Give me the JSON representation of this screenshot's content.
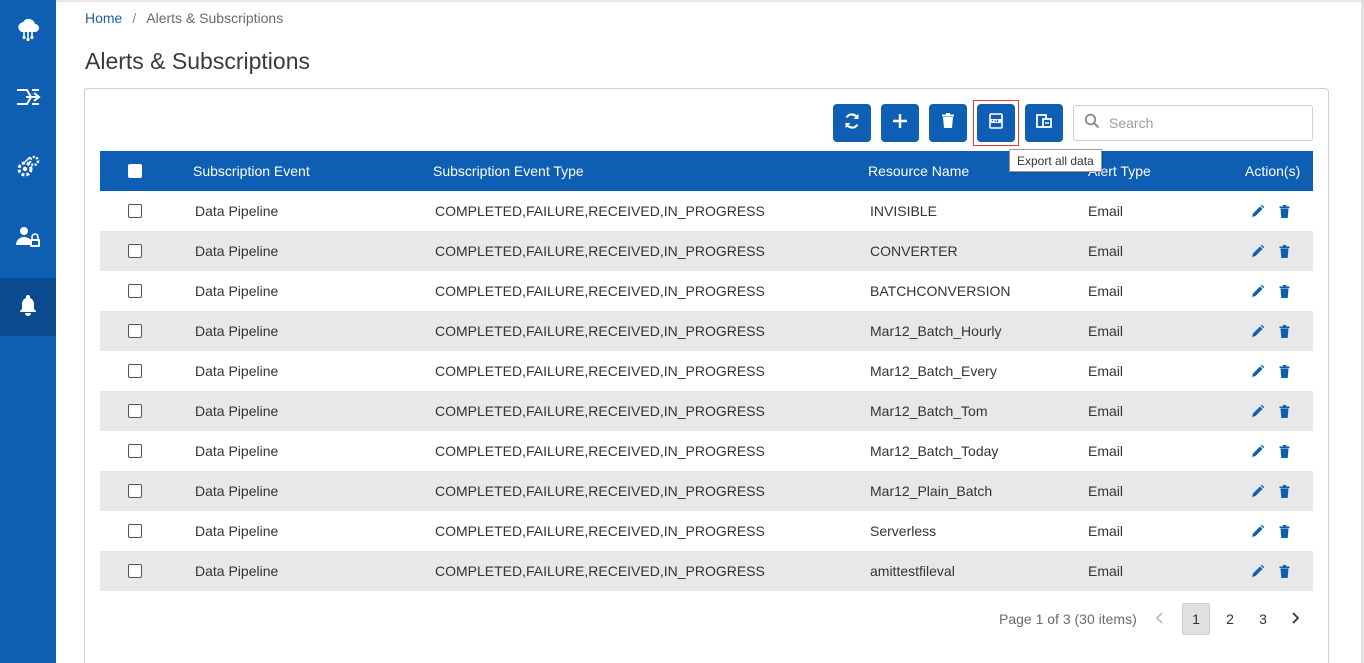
{
  "sidebar": {
    "items": [
      {
        "icon": "cloud-network-icon"
      },
      {
        "icon": "pipeline-flow-icon"
      },
      {
        "icon": "settings-gears-icon"
      },
      {
        "icon": "user-lock-icon"
      },
      {
        "icon": "bell-icon",
        "active": true
      }
    ]
  },
  "breadcrumb": {
    "home": "Home",
    "separator": "/",
    "current": "Alerts & Subscriptions"
  },
  "page_title": "Alerts & Subscriptions",
  "toolbar": {
    "buttons": [
      "refresh-icon",
      "plus-icon",
      "trash-icon",
      "xlsx-export-icon",
      "export-copy-icon"
    ],
    "tooltip": "Export all data",
    "search_placeholder": "Search"
  },
  "table": {
    "columns": [
      "Subscription Event",
      "Subscription Event Type",
      "Resource Name",
      "Alert Type",
      "Action(s)"
    ],
    "rows": [
      {
        "event": "Data Pipeline",
        "type": "COMPLETED,FAILURE,RECEIVED,IN_PROGRESS",
        "resource": "INVISIBLE",
        "alert": "Email"
      },
      {
        "event": "Data Pipeline",
        "type": "COMPLETED,FAILURE,RECEIVED,IN_PROGRESS",
        "resource": "CONVERTER",
        "alert": "Email"
      },
      {
        "event": "Data Pipeline",
        "type": "COMPLETED,FAILURE,RECEIVED,IN_PROGRESS",
        "resource": "BATCHCONVERSION",
        "alert": "Email"
      },
      {
        "event": "Data Pipeline",
        "type": "COMPLETED,FAILURE,RECEIVED,IN_PROGRESS",
        "resource": "Mar12_Batch_Hourly",
        "alert": "Email"
      },
      {
        "event": "Data Pipeline",
        "type": "COMPLETED,FAILURE,RECEIVED,IN_PROGRESS",
        "resource": "Mar12_Batch_Every",
        "alert": "Email"
      },
      {
        "event": "Data Pipeline",
        "type": "COMPLETED,FAILURE,RECEIVED,IN_PROGRESS",
        "resource": "Mar12_Batch_Tom",
        "alert": "Email"
      },
      {
        "event": "Data Pipeline",
        "type": "COMPLETED,FAILURE,RECEIVED,IN_PROGRESS",
        "resource": "Mar12_Batch_Today",
        "alert": "Email"
      },
      {
        "event": "Data Pipeline",
        "type": "COMPLETED,FAILURE,RECEIVED,IN_PROGRESS",
        "resource": "Mar12_Plain_Batch",
        "alert": "Email"
      },
      {
        "event": "Data Pipeline",
        "type": "COMPLETED,FAILURE,RECEIVED,IN_PROGRESS",
        "resource": "Serverless",
        "alert": "Email"
      },
      {
        "event": "Data Pipeline",
        "type": "COMPLETED,FAILURE,RECEIVED,IN_PROGRESS",
        "resource": "amittestfileval",
        "alert": "Email"
      }
    ]
  },
  "pagination": {
    "info": "Page 1 of 3 (30 items)",
    "pages": [
      "1",
      "2",
      "3"
    ],
    "current": "1"
  },
  "colors": {
    "primary": "#0e5fb3",
    "sidebar_active": "#0b4a8e",
    "row_alt": "#e8e8e8",
    "highlight": "#e53935"
  }
}
